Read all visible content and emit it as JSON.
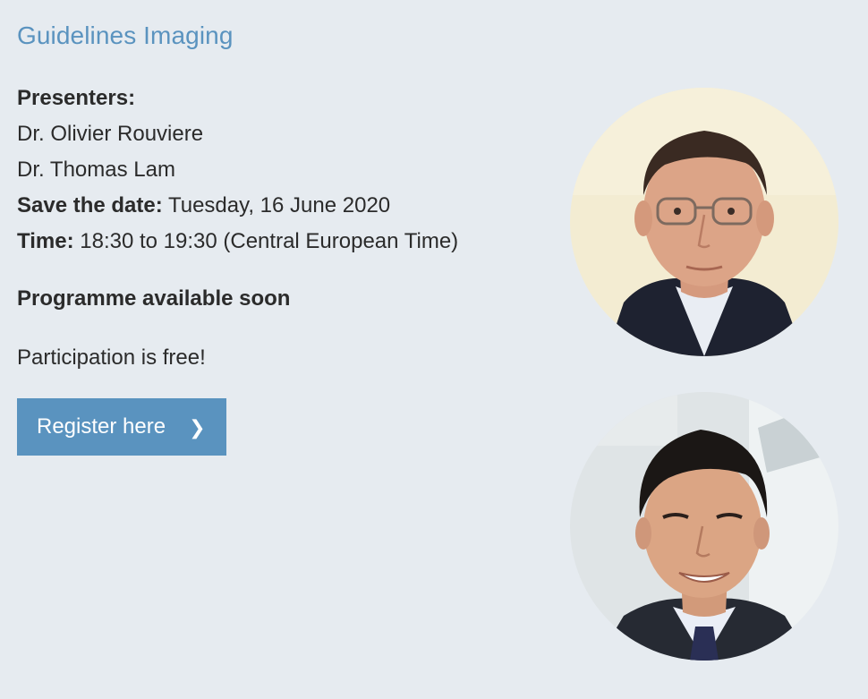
{
  "event": {
    "title": "Guidelines Imaging",
    "presenters_label": "Presenters:",
    "presenters": [
      "Dr. Olivier Rouviere",
      "Dr. Thomas Lam"
    ],
    "date_label": "Save the date:",
    "date_value": "Tuesday, 16 June 2020",
    "time_label": "Time:",
    "time_value": "18:30 to 19:30 (Central European Time)",
    "programme": "Programme available soon",
    "participation": "Participation is free!",
    "register_label": "Register here",
    "register_icon": "chevron-right-icon",
    "register_arrow": "❯"
  },
  "colors": {
    "background": "#e6ebf0",
    "accent": "#5a93bf",
    "text": "#2b2b2b"
  }
}
